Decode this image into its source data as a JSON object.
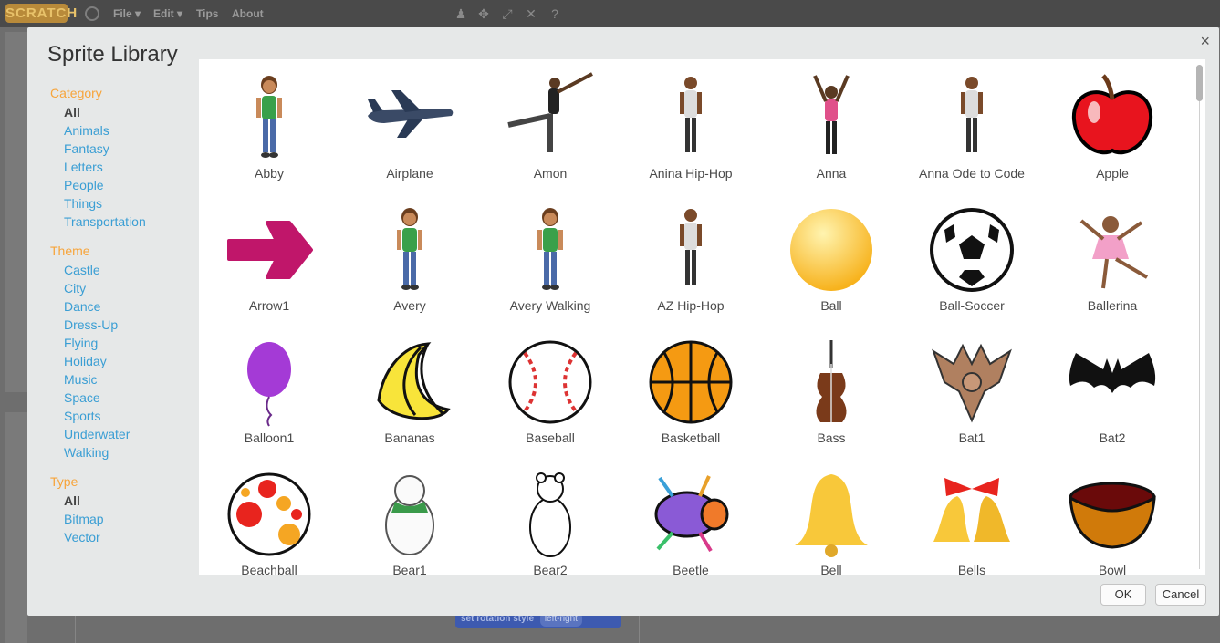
{
  "editor": {
    "logo": "SCRATCH",
    "menus": [
      "File ▾",
      "Edit ▾",
      "Tips",
      "About"
    ],
    "block_text": "set rotation style",
    "block_value": "left-right"
  },
  "dialog": {
    "title": "Sprite Library",
    "close": "×",
    "ok_label": "OK",
    "cancel_label": "Cancel"
  },
  "filters": {
    "category": {
      "heading": "Category",
      "items": [
        "All",
        "Animals",
        "Fantasy",
        "Letters",
        "People",
        "Things",
        "Transportation"
      ],
      "selected": "All"
    },
    "theme": {
      "heading": "Theme",
      "items": [
        "Castle",
        "City",
        "Dance",
        "Dress-Up",
        "Flying",
        "Holiday",
        "Music",
        "Space",
        "Sports",
        "Underwater",
        "Walking"
      ]
    },
    "type": {
      "heading": "Type",
      "items": [
        "All",
        "Bitmap",
        "Vector"
      ],
      "selected": "All"
    }
  },
  "sprites": [
    {
      "name": "Abby",
      "icon": "person-girl"
    },
    {
      "name": "Airplane",
      "icon": "airplane"
    },
    {
      "name": "Amon",
      "icon": "person-dancer"
    },
    {
      "name": "Anina Hip-Hop",
      "icon": "person"
    },
    {
      "name": "Anna",
      "icon": "person-arms-up"
    },
    {
      "name": "Anna Ode to Code",
      "icon": "person"
    },
    {
      "name": "Apple",
      "icon": "apple"
    },
    {
      "name": "Arrow1",
      "icon": "arrow"
    },
    {
      "name": "Avery",
      "icon": "person-girl"
    },
    {
      "name": "Avery Walking",
      "icon": "person-girl"
    },
    {
      "name": "AZ Hip-Hop",
      "icon": "person"
    },
    {
      "name": "Ball",
      "icon": "ball"
    },
    {
      "name": "Ball-Soccer",
      "icon": "soccer-ball"
    },
    {
      "name": "Ballerina",
      "icon": "ballerina"
    },
    {
      "name": "Balloon1",
      "icon": "balloon"
    },
    {
      "name": "Bananas",
      "icon": "bananas"
    },
    {
      "name": "Baseball",
      "icon": "baseball"
    },
    {
      "name": "Basketball",
      "icon": "basketball"
    },
    {
      "name": "Bass",
      "icon": "bass"
    },
    {
      "name": "Bat1",
      "icon": "bat-brown"
    },
    {
      "name": "Bat2",
      "icon": "bat-black"
    },
    {
      "name": "Beachball",
      "icon": "beachball"
    },
    {
      "name": "Bear1",
      "icon": "bear"
    },
    {
      "name": "Bear2",
      "icon": "bear-outline"
    },
    {
      "name": "Beetle",
      "icon": "beetle"
    },
    {
      "name": "Bell",
      "icon": "bell"
    },
    {
      "name": "Bells",
      "icon": "bells"
    },
    {
      "name": "Bowl",
      "icon": "bowl"
    }
  ],
  "colors": {
    "accent_heading": "#f7a43a",
    "link": "#3a9ed4",
    "apple": "#e8141e",
    "arrow": "#c0166a",
    "ball": "#f7b21c",
    "balloon": "#a43ad6",
    "basketball": "#f59a12"
  }
}
